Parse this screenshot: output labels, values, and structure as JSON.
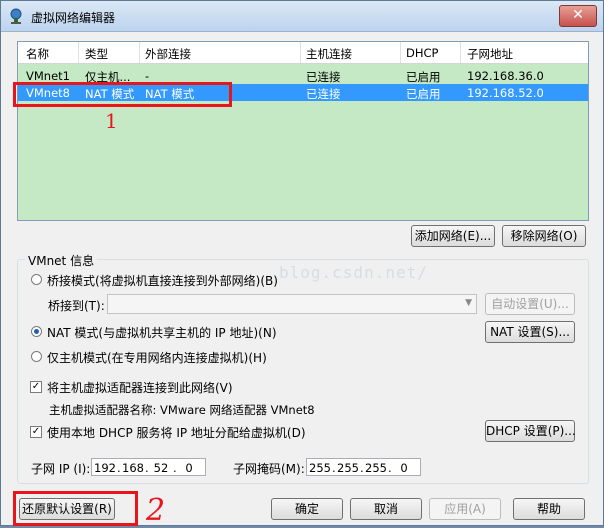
{
  "window": {
    "title": "虚拟网络编辑器",
    "close_glyph": "✕"
  },
  "table": {
    "columns": [
      "名称",
      "类型",
      "外部连接",
      "主机连接",
      "DHCP",
      "子网地址"
    ],
    "rows": [
      {
        "name": "VMnet1",
        "type": "仅主机...",
        "external": "-",
        "host": "已连接",
        "dhcp": "已启用",
        "subnet": "192.168.36.0"
      },
      {
        "name": "VMnet8",
        "type": "NAT 模式",
        "external": "NAT 模式",
        "host": "已连接",
        "dhcp": "已启用",
        "subnet": "192.168.52.0"
      }
    ]
  },
  "buttons": {
    "add_network": "添加网络(E)...",
    "remove_network": "移除网络(O)",
    "auto_settings": "自动设置(U)...",
    "nat_settings": "NAT 设置(S)...",
    "dhcp_settings": "DHCP 设置(P)...",
    "restore_defaults": "还原默认设置(R)",
    "ok": "确定",
    "cancel": "取消",
    "apply": "应用(A)",
    "help": "帮助"
  },
  "vmnet_info": {
    "title": "VMnet 信息",
    "bridged_mode": "桥接模式(将虚拟机直接连接到外部网络)(B)",
    "bridged_to_label": "桥接到(T):",
    "bridged_to_value": "",
    "nat_mode": "NAT 模式(与虚拟机共享主机的 IP 地址)(N)",
    "host_only_mode": "仅主机模式(在专用网络内连接虚拟机)(H)",
    "connect_adapter": "将主机虚拟适配器连接到此网络(V)",
    "adapter_name": "主机虚拟适配器名称: VMware 网络适配器 VMnet8",
    "use_dhcp": "使用本地 DHCP 服务将 IP 地址分配给虚拟机(D)",
    "subnet_ip_label": "子网 IP (I):",
    "subnet_ip": [
      "192",
      "168",
      "52",
      "0"
    ],
    "subnet_mask_label": "子网掩码(M):",
    "subnet_mask": [
      "255",
      "255",
      "255",
      "0"
    ],
    "selected_mode": "nat",
    "connect_adapter_checked": true,
    "use_dhcp_checked": true
  },
  "watermark": "blog.csdn.net/",
  "annotations": {
    "mark1": "1",
    "mark2": "2"
  },
  "colors": {
    "list_bg": "#c4e9c4",
    "selection": "#3399ff",
    "annotation": "#e8161c"
  }
}
